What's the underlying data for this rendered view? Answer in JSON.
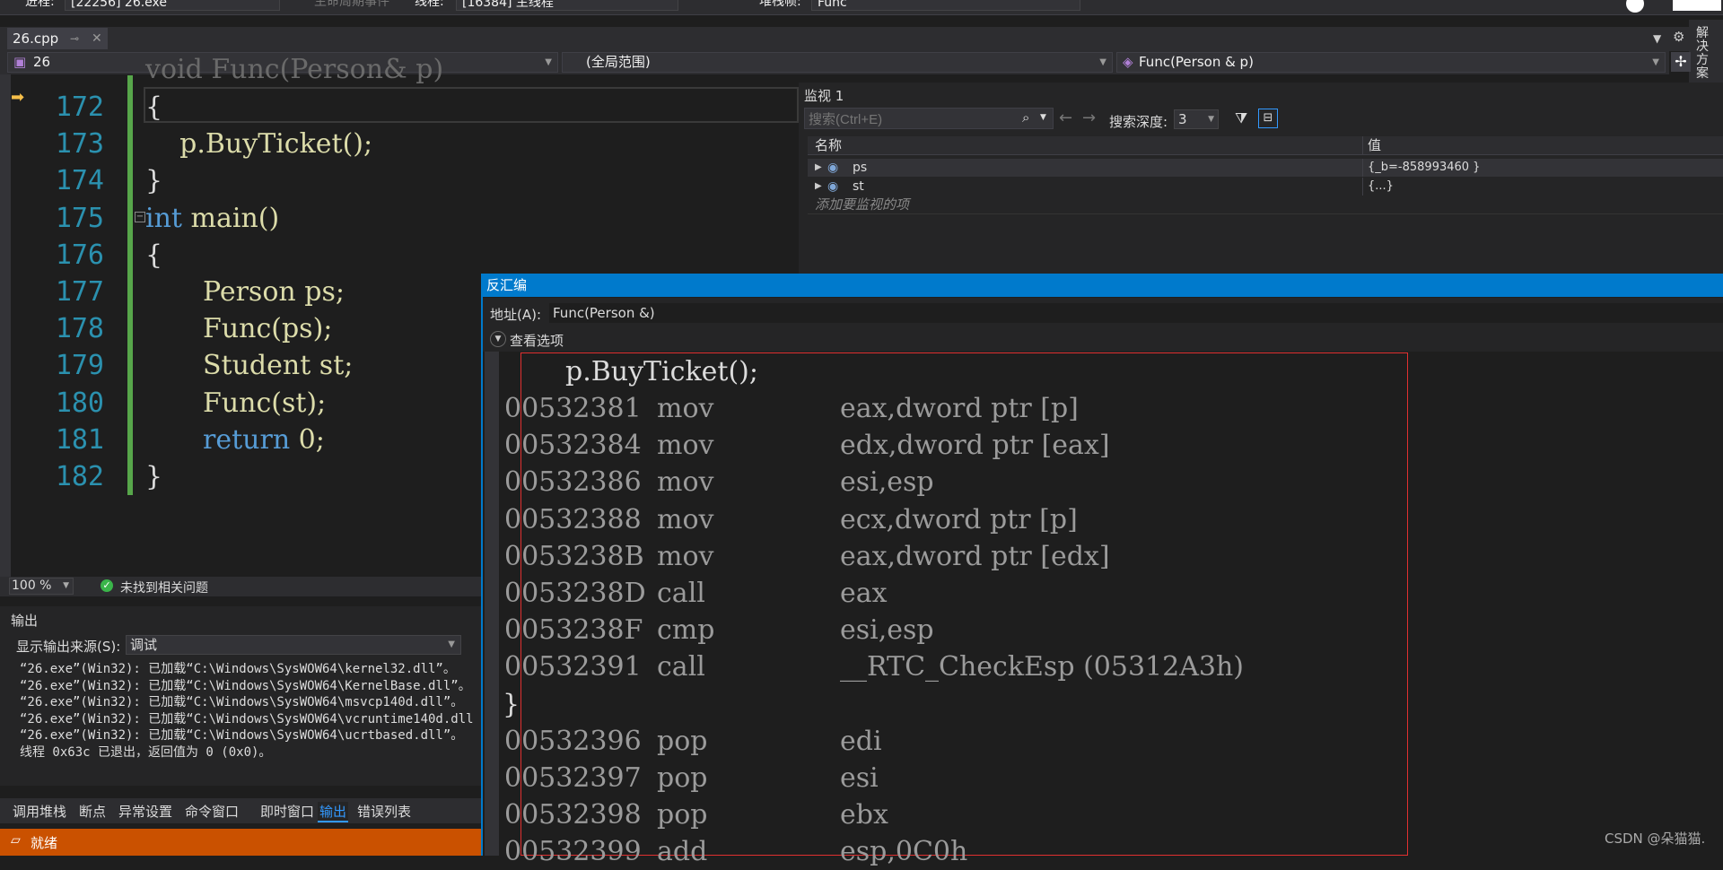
{
  "toolbar": {
    "process_label": "进程:",
    "process_value": "[22256] 26.exe",
    "lifecycle_label": "生命周期事件",
    "thread_label": "线程:",
    "thread_value": "[16384] 主线程",
    "stackframe_label": "堆栈帧:",
    "stackframe_value": "Func"
  },
  "document_tab": {
    "title": "26.cpp",
    "pin_icon": "pin-icon",
    "close_icon": "close-icon"
  },
  "navbar": {
    "project": "26",
    "scope": "(全局范围)",
    "member": "Func(Person & p)"
  },
  "solution_explorer_label": "解决方案",
  "editor": {
    "top_partial": "void Func(Person& p)",
    "lines": [
      {
        "num": "172",
        "text": "{"
      },
      {
        "num": "173",
        "text": "    p.BuyTicket();"
      },
      {
        "num": "174",
        "text": "}"
      },
      {
        "num": "175",
        "kw": "int",
        "rest": " main()"
      },
      {
        "num": "176",
        "text": "{"
      },
      {
        "num": "177",
        "type": "Person",
        "rest": " ps;"
      },
      {
        "num": "178",
        "fn": "Func",
        "rest": "(ps);"
      },
      {
        "num": "179",
        "type": "Student",
        "rest": " st;"
      },
      {
        "num": "180",
        "fn": "Func",
        "rest": "(st);"
      },
      {
        "num": "181",
        "kw": "return",
        "rest": " 0;"
      },
      {
        "num": "182",
        "text": "}"
      }
    ],
    "zoom": "100 %",
    "issues": "未找到相关问题"
  },
  "output": {
    "title": "输出",
    "source_label": "显示输出来源(S):",
    "source_value": "调试",
    "lines": [
      "“26.exe”(Win32): 已加载“C:\\Windows\\SysWOW64\\kernel32.dll”。",
      "“26.exe”(Win32): 已加载“C:\\Windows\\SysWOW64\\KernelBase.dll”。",
      "“26.exe”(Win32): 已加载“C:\\Windows\\SysWOW64\\msvcp140d.dll”。",
      "“26.exe”(Win32): 已加载“C:\\Windows\\SysWOW64\\vcruntime140d.dll",
      "“26.exe”(Win32): 已加载“C:\\Windows\\SysWOW64\\ucrtbased.dll”。",
      "线程 0x63c 已退出，返回值为 0 (0x0)。"
    ]
  },
  "bottom_tabs": [
    "调用堆栈",
    "断点",
    "异常设置",
    "命令窗口",
    "即时窗口",
    "输出",
    "错误列表"
  ],
  "active_bottom_tab": "输出",
  "status": {
    "text": "就绪"
  },
  "watch": {
    "title": "监视 1",
    "search_placeholder": "搜索(Ctrl+E)",
    "depth_label": "搜索深度:",
    "depth_value": "3",
    "col_name": "名称",
    "col_value": "值",
    "rows": [
      {
        "name": "ps",
        "value": "{_b=-858993460 }"
      },
      {
        "name": "st",
        "value": "{...}"
      }
    ],
    "add_placeholder": "添加要监视的项"
  },
  "disasm": {
    "title": "反汇编",
    "address_label": "地址(A):",
    "address_value": "Func(Person &)",
    "view_options": "查看选项",
    "source_line": "p.BuyTicket();",
    "instructions": [
      {
        "addr": "00532381",
        "op": "mov",
        "args": "eax,dword ptr [p]"
      },
      {
        "addr": "00532384",
        "op": "mov",
        "args": "edx,dword ptr [eax]"
      },
      {
        "addr": "00532386",
        "op": "mov",
        "args": "esi,esp"
      },
      {
        "addr": "00532388",
        "op": "mov",
        "args": "ecx,dword ptr [p]"
      },
      {
        "addr": "0053238B",
        "op": "mov",
        "args": "eax,dword ptr [edx]"
      },
      {
        "addr": "0053238D",
        "op": "call",
        "args": "eax"
      },
      {
        "addr": "0053238F",
        "op": "cmp",
        "args": "esi,esp"
      },
      {
        "addr": "00532391",
        "op": "call",
        "args": "__RTC_CheckEsp (05312A3h)"
      }
    ],
    "brace": "}",
    "instructions2": [
      {
        "addr": "00532396",
        "op": "pop",
        "args": "edi"
      },
      {
        "addr": "00532397",
        "op": "pop",
        "args": "esi"
      },
      {
        "addr": "00532398",
        "op": "pop",
        "args": "ebx"
      },
      {
        "addr": "00532399",
        "op": "add",
        "args": "esp,0C0h"
      }
    ]
  },
  "watermark": "CSDN @朵猫猫.",
  "colors": {
    "accent": "#007acc",
    "status": "#ca5100",
    "line_number": "#2b91af",
    "keyword": "#569cd6",
    "type": "#4ec9b0",
    "function": "#dcdcaa"
  }
}
